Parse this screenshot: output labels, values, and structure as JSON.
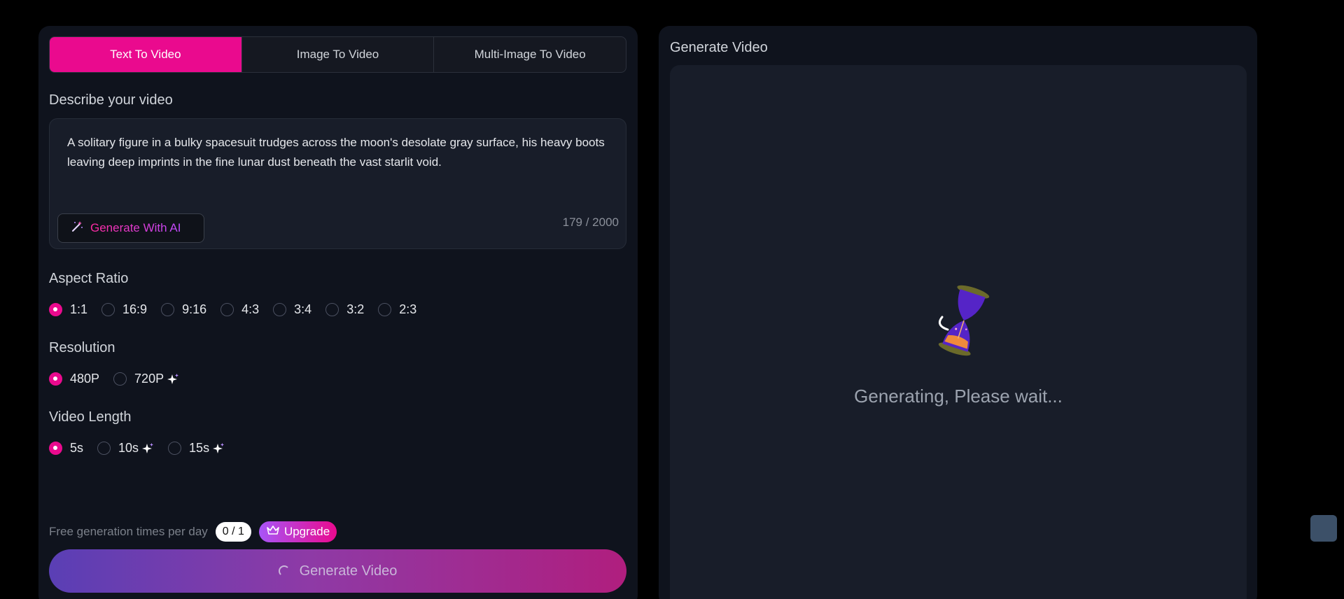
{
  "tabs": [
    {
      "label": "Text To Video",
      "active": true
    },
    {
      "label": "Image To Video",
      "active": false
    },
    {
      "label": "Multi-Image To Video",
      "active": false
    }
  ],
  "describe": {
    "label": "Describe your video",
    "text": "A solitary figure in a bulky spacesuit trudges across the moon's desolate gray surface, his heavy boots leaving deep imprints in the fine lunar dust beneath the vast starlit void.",
    "generate_ai_label": "Generate With AI",
    "counter": "179 / 2000"
  },
  "aspect_ratio": {
    "label": "Aspect Ratio",
    "options": [
      "1:1",
      "16:9",
      "9:16",
      "4:3",
      "3:4",
      "3:2",
      "2:3"
    ],
    "selected": "1:1"
  },
  "resolution": {
    "label": "Resolution",
    "options": [
      "480P",
      "720P"
    ],
    "selected": "480P"
  },
  "video_length": {
    "label": "Video Length",
    "options": [
      "5s",
      "10s",
      "15s"
    ],
    "selected": "5s"
  },
  "quota": {
    "text": "Free generation times per day",
    "badge": "0 / 1",
    "upgrade_label": "Upgrade"
  },
  "generate_button": {
    "label": "Generate Video"
  },
  "preview": {
    "title": "Generate Video",
    "status": "Generating, Please wait..."
  },
  "colors": {
    "accent": "#ea0a8e",
    "panel": "#0f131d",
    "surface": "#181d29"
  }
}
